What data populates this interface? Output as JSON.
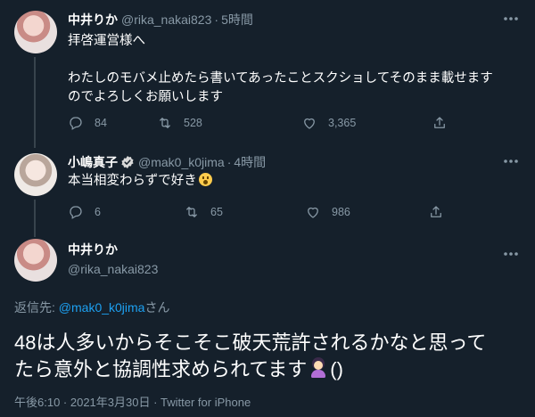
{
  "tweets": [
    {
      "name": "中井りか",
      "handle": "@rika_nakai823",
      "dot": "·",
      "time": "5時間",
      "text_line1": "拝啓運営様へ",
      "text_line2": "わたしのモバメ止めたら書いてあったことスクショしてそのまま載せます",
      "text_line3": "のでよろしくお願いします",
      "replies": "84",
      "retweets": "528",
      "likes": "3,365"
    },
    {
      "name": "小嶋真子",
      "handle": "@mak0_k0jima",
      "dot": "·",
      "time": "4時間",
      "text": "本当相変わらずで好き",
      "emoji": "astonished-face",
      "replies": "6",
      "retweets": "65",
      "likes": "986"
    }
  ],
  "main_tweet": {
    "name": "中井りか",
    "handle": "@rika_nakai823",
    "reply_prefix": "返信先: ",
    "reply_mention": "@mak0_k0jima",
    "reply_suffix": "さん",
    "text_line1": "48は人多いからそこそこ破天荒許されるかなと思って",
    "text_line2": "たら意外と協調性求められてます",
    "text_tail": "()",
    "emoji": "person-tipping-hand",
    "meta": "午後6:10 · 2021年3月30日 · Twitter for iPhone"
  },
  "colors": {
    "background": "#15202b",
    "text": "#ffffff",
    "secondary": "#8899a6",
    "link": "#1da1f2",
    "verified": "#1da1f2"
  },
  "icons": [
    "more-icon",
    "reply-icon",
    "retweet-icon",
    "like-icon",
    "share-icon",
    "verified-badge-icon"
  ]
}
